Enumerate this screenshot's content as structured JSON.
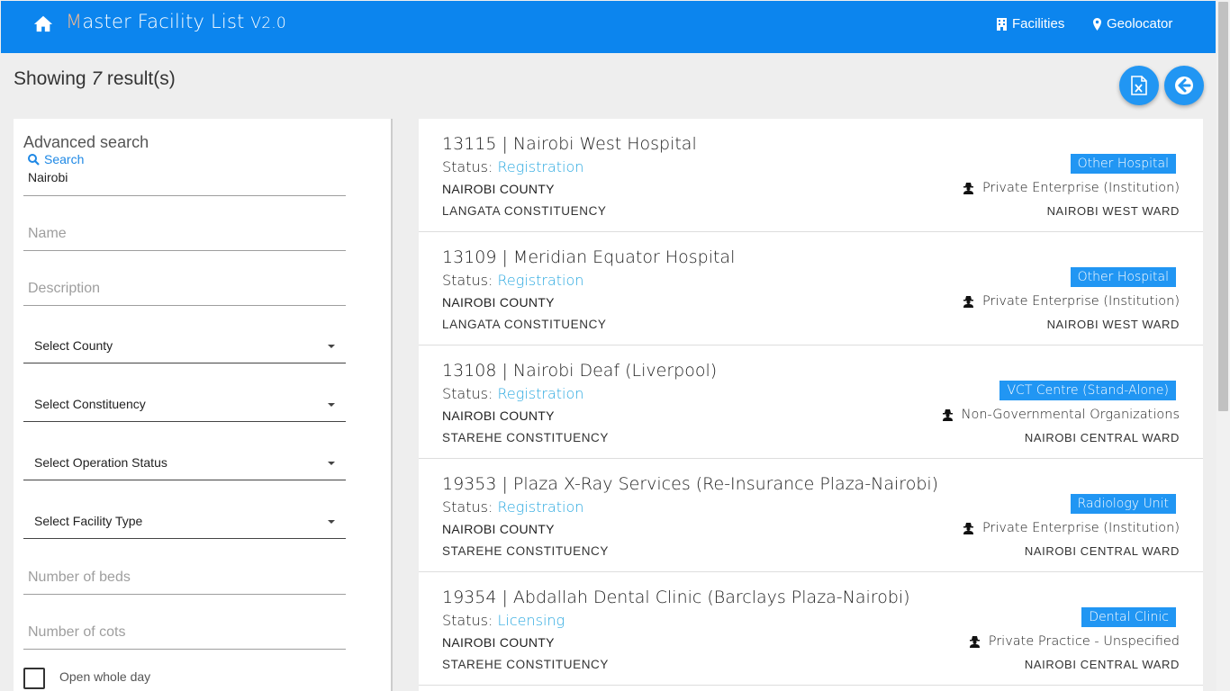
{
  "header": {
    "brand_first": "M",
    "brand_rest": "aster Facility List ",
    "brand_version": "V2.0",
    "nav_facilities": "Facilities",
    "nav_geolocator": "Geolocator"
  },
  "summary": {
    "prefix": "Showing ",
    "count": "7",
    "suffix": " result(s)"
  },
  "sidebar": {
    "title": "Advanced search",
    "search_label": "Search",
    "search_value": "Nairobi",
    "name_placeholder": "Name",
    "description_placeholder": "Description",
    "select_county": "Select County",
    "select_constituency": "Select Constituency",
    "select_operation_status": "Select Operation Status",
    "select_facility_type": "Select Facility Type",
    "beds_placeholder": "Number of beds",
    "cots_placeholder": "Number of cots",
    "open_whole_day": "Open whole day"
  },
  "results": [
    {
      "title": "13115 | Nairobi West Hospital",
      "status_label": "Status:",
      "status": "Registration",
      "county": "NAIROBI COUNTY",
      "constituency": "LANGATA CONSTITUENCY",
      "type": "Other Hospital",
      "owner": "Private Enterprise (Institution)",
      "ward": "NAIROBI WEST WARD"
    },
    {
      "title": "13109 | Meridian Equator Hospital",
      "status_label": "Status:",
      "status": "Registration",
      "county": "NAIROBI COUNTY",
      "constituency": "LANGATA CONSTITUENCY",
      "type": "Other Hospital",
      "owner": "Private Enterprise (Institution)",
      "ward": "NAIROBI WEST WARD"
    },
    {
      "title": "13108 | Nairobi Deaf (Liverpool)",
      "status_label": "Status:",
      "status": "Registration",
      "county": "NAIROBI COUNTY",
      "constituency": "STAREHE CONSTITUENCY",
      "type": "VCT Centre (Stand-Alone)",
      "owner": "Non-Governmental Organizations",
      "ward": "NAIROBI CENTRAL WARD"
    },
    {
      "title": "19353 | Plaza X-Ray Services (Re-Insurance Plaza-Nairobi)",
      "status_label": "Status:",
      "status": "Registration",
      "county": "NAIROBI COUNTY",
      "constituency": "STAREHE CONSTITUENCY",
      "type": "Radiology Unit",
      "owner": "Private Enterprise (Institution)",
      "ward": "NAIROBI CENTRAL WARD"
    },
    {
      "title": "19354 | Abdallah Dental Clinic (Barclays Plaza-Nairobi)",
      "status_label": "Status:",
      "status": "Licensing",
      "county": "NAIROBI COUNTY",
      "constituency": "STAREHE CONSTITUENCY",
      "type": "Dental Clinic",
      "owner": "Private Practice - Unspecified",
      "ward": "NAIROBI CENTRAL WARD"
    }
  ],
  "icons": {
    "home": "home-icon",
    "facilities": "building-icon",
    "geolocator": "map-marker-icon",
    "export": "excel-file-icon",
    "back": "arrow-left-icon",
    "search": "search-icon",
    "owner": "user-secret-icon"
  },
  "colors": {
    "primary": "#0c85ee",
    "badge": "#2196f3",
    "status": "#29a8e0"
  }
}
